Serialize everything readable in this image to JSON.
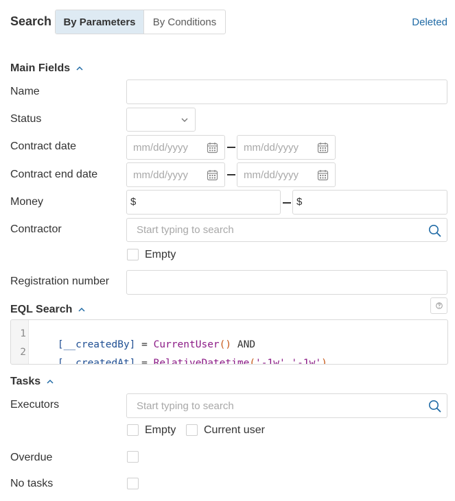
{
  "header": {
    "search_label": "Search",
    "tabs": [
      {
        "label": "By Parameters",
        "active": true
      },
      {
        "label": "By Conditions",
        "active": false
      }
    ],
    "deleted_link": "Deleted"
  },
  "main_fields": {
    "title": "Main Fields",
    "name_label": "Name",
    "status_label": "Status",
    "contract_date_label": "Contract date",
    "contract_end_date_label": "Contract end date",
    "date_placeholder": "mm/dd/yyyy",
    "money_label": "Money",
    "currency_symbol": "$",
    "contractor_label": "Contractor",
    "contractor_placeholder": "Start typing to search",
    "empty_label": "Empty",
    "registration_number_label": "Registration number"
  },
  "eql": {
    "title": "EQL Search",
    "help_icon": "question-icon",
    "lines": [
      {
        "num": "1",
        "field": "[__createdBy]",
        "op": " = ",
        "fn": "CurrentUser",
        "open": "(",
        "args": "",
        "close": ")",
        "tail": " AND"
      },
      {
        "num": "2",
        "field": "[__createdAt]",
        "op": " = ",
        "fn": "RelativeDatetime",
        "open": "(",
        "args": "'-1w','-1w'",
        "close": ")",
        "tail": ""
      }
    ]
  },
  "tasks": {
    "title": "Tasks",
    "executors_label": "Executors",
    "executors_placeholder": "Start typing to search",
    "empty_label": "Empty",
    "current_user_label": "Current user",
    "overdue_label": "Overdue",
    "no_tasks_label": "No tasks"
  },
  "colors": {
    "accent_link": "#1f6aa5",
    "active_tab_bg": "#deeaf3",
    "search_icon": "#1f6aa5"
  }
}
